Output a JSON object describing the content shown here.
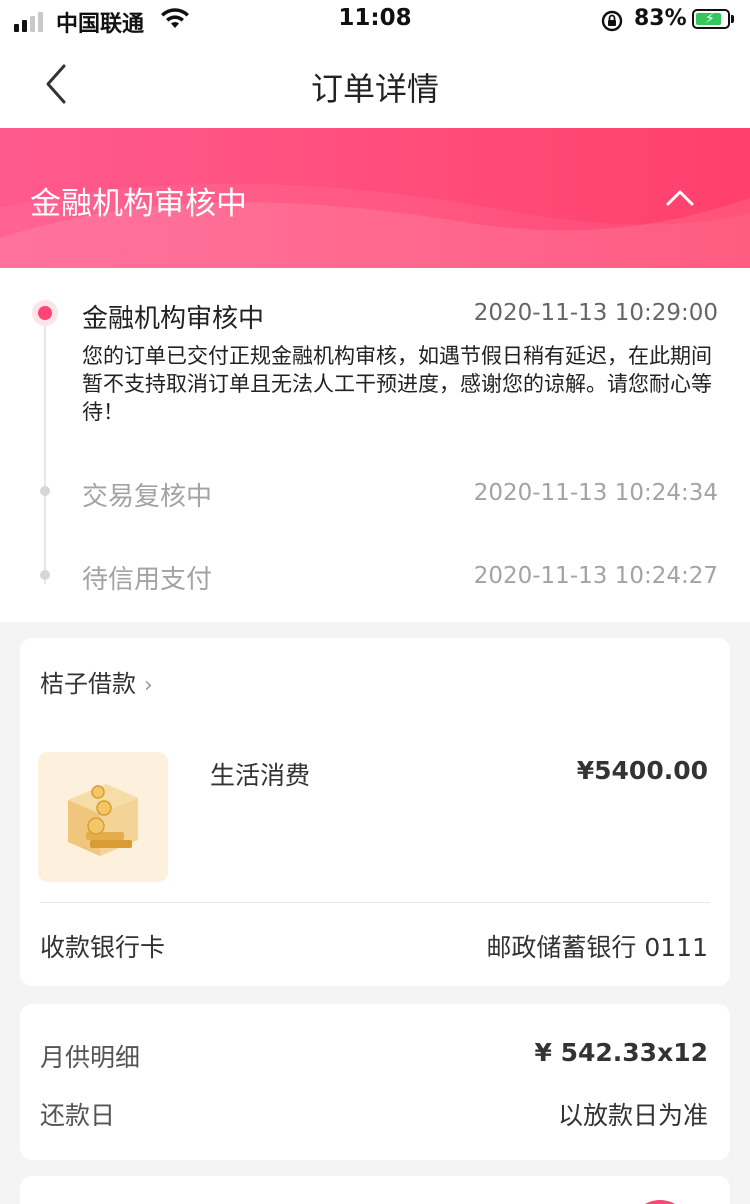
{
  "status_bar": {
    "carrier": "中国联通",
    "time": "11:08",
    "battery_percent": "83%",
    "battery_level": 0.83
  },
  "nav": {
    "title": "订单详情"
  },
  "banner": {
    "status": "金融机构审核中"
  },
  "timeline": {
    "steps": [
      {
        "title": "金融机构审核中",
        "time": "2020-11-13 10:29:00",
        "description": "您的订单已交付正规金融机构审核，如遇节假日稍有延迟，在此期间暂不支持取消订单且无法人工干预进度，感谢您的谅解。请您耐心等待！"
      },
      {
        "title": "交易复核中",
        "time": "2020-11-13 10:24:34"
      },
      {
        "title": "待信用支付",
        "time": "2020-11-13 10:24:27"
      }
    ]
  },
  "order": {
    "merchant": "桔子借款",
    "purpose": "生活消费",
    "amount": "¥5400.00",
    "bank_label": "收款银行卡",
    "bank_value": "邮政储蓄银行 0111"
  },
  "repayment": {
    "monthly_label": "月供明细",
    "monthly_value": "¥ 542.33x12",
    "date_label": "还款日",
    "date_value": "以放款日为准"
  },
  "colors": {
    "accent": "#ff4577",
    "banner_start": "#ff5a8e",
    "banner_end": "#ff3f6c"
  }
}
